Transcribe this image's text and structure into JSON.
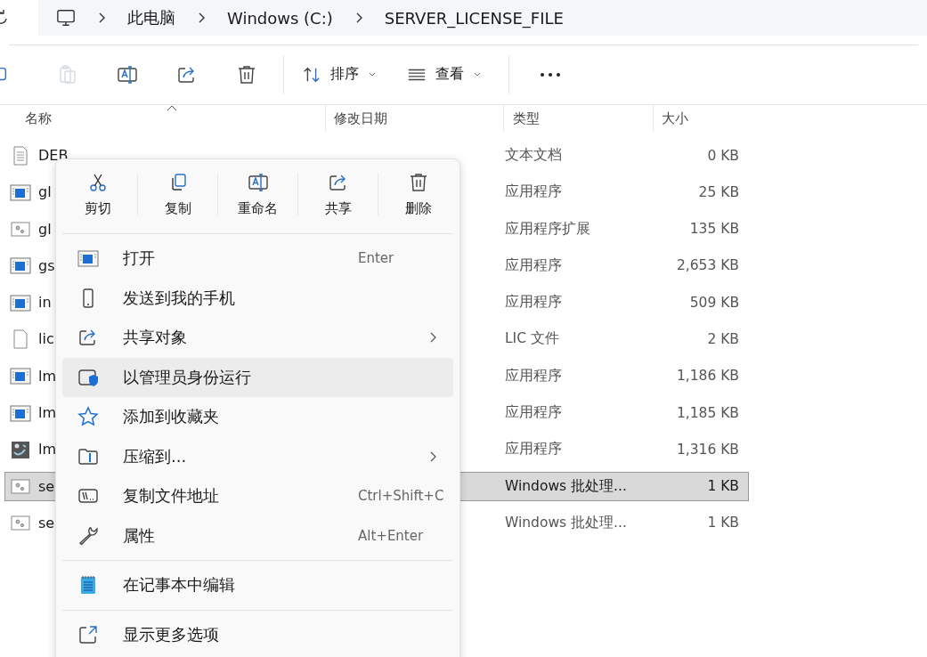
{
  "address_bar": {
    "crumbs": [
      "此电脑",
      "Windows (C:)",
      "SERVER_LICENSE_FILE"
    ]
  },
  "toolbar": {
    "icon_buttons": [
      {
        "kind": "paste",
        "disabled": true
      },
      {
        "kind": "rename",
        "disabled": false
      },
      {
        "kind": "share",
        "disabled": false
      },
      {
        "kind": "delete",
        "disabled": false
      }
    ],
    "menus": [
      {
        "kind": "sort",
        "label": "排序"
      },
      {
        "kind": "view",
        "label": "查看"
      }
    ]
  },
  "columns": [
    {
      "label": "名称",
      "sorted": true
    },
    {
      "label": "修改日期",
      "sorted": false
    },
    {
      "label": "类型",
      "sorted": false
    },
    {
      "label": "大小",
      "sorted": false
    }
  ],
  "rows": [
    {
      "name": "DEB",
      "kind": "text",
      "type": "文本文档",
      "size": "0 KB",
      "selected": false
    },
    {
      "name": "gl",
      "kind": "app",
      "type": "应用程序",
      "size": "25 KB",
      "selected": false
    },
    {
      "name": "gl",
      "kind": "gear",
      "type": "应用程序扩展",
      "size": "135 KB",
      "selected": false
    },
    {
      "name": "gs",
      "kind": "app",
      "type": "应用程序",
      "size": "2,653 KB",
      "selected": false
    },
    {
      "name": "in",
      "kind": "app",
      "type": "应用程序",
      "size": "509 KB",
      "selected": false
    },
    {
      "name": "lic",
      "kind": "blank",
      "type": "LIC 文件",
      "size": "2 KB",
      "selected": false
    },
    {
      "name": "lm",
      "kind": "app",
      "type": "应用程序",
      "size": "1,186 KB",
      "selected": false
    },
    {
      "name": "lm",
      "kind": "app",
      "type": "应用程序",
      "size": "1,185 KB",
      "selected": false
    },
    {
      "name": "lm",
      "kind": "tool",
      "type": "应用程序",
      "size": "1,316 KB",
      "selected": false
    },
    {
      "name": "se",
      "kind": "gear",
      "type": "Windows 批处理...",
      "size": "1 KB",
      "selected": true
    },
    {
      "name": "se",
      "kind": "gear",
      "type": "Windows 批处理...",
      "size": "1 KB",
      "selected": false
    }
  ],
  "context_menu": {
    "actions": [
      {
        "kind": "cut",
        "label": "剪切"
      },
      {
        "kind": "copy",
        "label": "复制"
      },
      {
        "kind": "rename",
        "label": "重命名"
      },
      {
        "kind": "share",
        "label": "共享"
      },
      {
        "kind": "delete",
        "label": "删除"
      }
    ],
    "groups": [
      [
        {
          "kind": "open",
          "label": "打开",
          "shortcut": "Enter",
          "submenu": false,
          "hovered": false
        },
        {
          "kind": "phone",
          "label": "发送到我的手机",
          "submenu": false,
          "hovered": false
        },
        {
          "kind": "share",
          "label": "共享对象",
          "submenu": true,
          "hovered": false
        },
        {
          "kind": "admin",
          "label": "以管理员身份运行",
          "submenu": false,
          "hovered": true
        },
        {
          "kind": "star",
          "label": "添加到收藏夹",
          "submenu": false,
          "hovered": false
        },
        {
          "kind": "zip",
          "label": "压缩到...",
          "submenu": true,
          "hovered": false
        },
        {
          "kind": "path",
          "label": "复制文件地址",
          "shortcut": "Ctrl+Shift+C",
          "submenu": false,
          "hovered": false
        },
        {
          "kind": "wrench",
          "label": "属性",
          "shortcut": "Alt+Enter",
          "submenu": false,
          "hovered": false
        }
      ],
      [
        {
          "kind": "notepad",
          "label": "在记事本中编辑",
          "submenu": false,
          "hovered": false
        }
      ],
      [
        {
          "kind": "more",
          "label": "显示更多选项",
          "submenu": false,
          "hovered": false
        }
      ]
    ]
  }
}
